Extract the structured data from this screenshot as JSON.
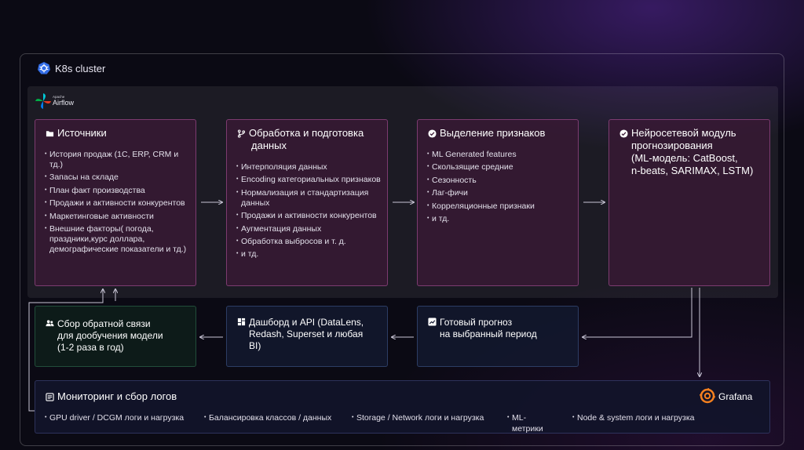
{
  "cluster": {
    "title": "K8s cluster"
  },
  "airflow": {
    "brand_small": "Apache",
    "brand": "Airflow"
  },
  "sources": {
    "title": "Источники",
    "items": [
      "История продаж (1С, ERP, CRM и тд.)",
      "Запасы на складе",
      "План факт производства",
      "Продажи и активности конкурентов",
      "Маркетинговые активности",
      "Внешние факторы( погода, праздники,курс доллара, демографические показатели и тд.)"
    ]
  },
  "processing": {
    "title_line1": "Обработка и подготовка",
    "title_line2": "данных",
    "items": [
      "Интерполяция данных",
      "Encoding категориальных признаков",
      "Нормализация и стандартизация данных",
      "Продажи и активности конкурентов",
      "Аугментация данных",
      "Обработка выбросов и т. д.",
      "и тд."
    ]
  },
  "features": {
    "title": "Выделение признаков",
    "items": [
      "ML Generated features",
      "Скользящие средние",
      "Сезонность",
      "Лаг-фичи",
      "Корреляционные признаки",
      "и тд."
    ]
  },
  "neural": {
    "title_lines": [
      "Нейросетевой модуль",
      "прогнозирования",
      "(ML-модель: CatBoost,",
      "n-beats, SARIMAX, LSTM)"
    ]
  },
  "feedback": {
    "title_lines": [
      "Сбор обратной связи",
      "для дообучения модели",
      "(1-2 раза в год)"
    ]
  },
  "dashboard": {
    "title_lines": [
      "Дашборд и API (DataLens,",
      "Redash, Superset и любая",
      "BI)"
    ]
  },
  "forecast": {
    "title_lines": [
      "Готовый прогноз",
      "на выбранный период"
    ]
  },
  "monitoring": {
    "title": "Мониторинг и сбор логов",
    "grafana": "Grafana",
    "items": [
      "GPU driver / DCGM логи и нагрузка",
      "Балансировка классов / данных",
      "Storage / Network логи и нагрузка",
      "ML-",
      "метрики",
      "Node & system логи и нагрузка"
    ]
  },
  "colors": {
    "accent_pink": "#b95aa5",
    "grafana_orange": "#f4801f",
    "k8s_blue": "#326ce5",
    "airflow_teal": "#00c7d4"
  }
}
